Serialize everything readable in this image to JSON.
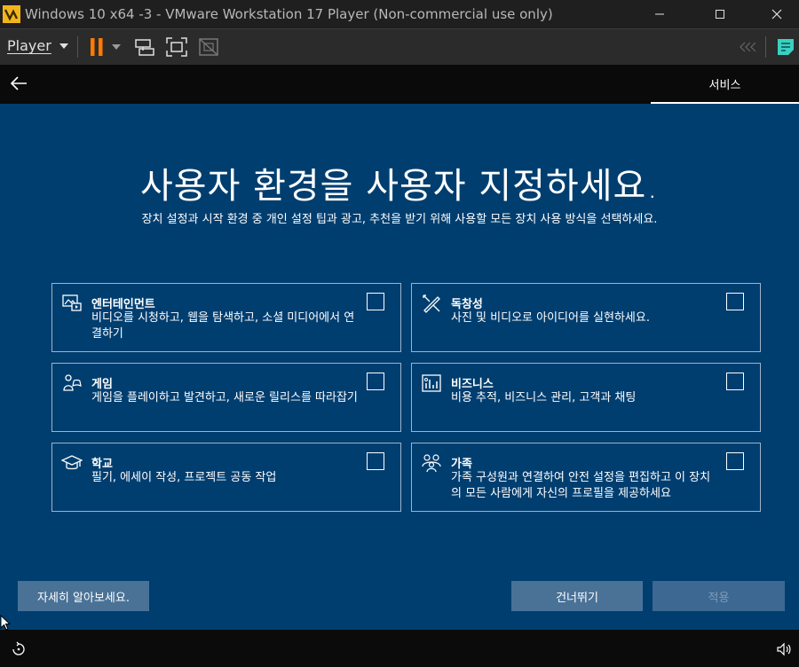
{
  "window": {
    "title": "Windows 10 x64 -3 - VMware Workstation 17 Player (Non-commercial use only)",
    "minimize_glyph": "—",
    "maximize_glyph": "☐",
    "close_glyph": "✕"
  },
  "toolbar": {
    "player_label": "Player",
    "accent_color": "#ff7a00",
    "icons": [
      "pause-icon",
      "send-keys-icon",
      "fullscreen-icon",
      "unity-icon",
      "collapse-icon",
      "notes-icon"
    ]
  },
  "oobe": {
    "tab_label": "서비스",
    "heading": "사용자 환경을 사용자 지정하세요.",
    "subheading": "장치 설정과 시작 환경 중 개인 설정 팁과 광고, 추천을 받기 위해 사용할 모든 장치 사용 방식을 선택하세요.",
    "background_color": "#003e70",
    "cards": [
      {
        "icon": "entertainment-icon",
        "title": "엔터테인먼트",
        "desc": "비디오를 시청하고, 웹을 탐색하고, 소셜 미디어에서 연결하기",
        "checked": false
      },
      {
        "icon": "creativity-icon",
        "title": "독창성",
        "desc": "사진 및 비디오로 아이디어를 실현하세요.",
        "checked": false
      },
      {
        "icon": "gaming-icon",
        "title": "게임",
        "desc": "게임을 플레이하고 발견하고, 새로운 릴리스를 따라잡기",
        "checked": false
      },
      {
        "icon": "business-icon",
        "title": "비즈니스",
        "desc": "비용 추적, 비즈니스 관리, 고객과 채팅",
        "checked": false
      },
      {
        "icon": "school-icon",
        "title": "학교",
        "desc": "필기, 에세이 작성, 프로젝트 공동 작업",
        "checked": false
      },
      {
        "icon": "family-icon",
        "title": "가족",
        "desc": "가족 구성원과 연결하여 안전 설정을 편집하고 이 장치의 모든 사람에게 자신의 프로필을 제공하세요",
        "checked": false
      }
    ],
    "learn_more_label": "자세히 알아보세요.",
    "skip_label": "건너뛰기",
    "apply_label": "적용"
  },
  "statusbar": {
    "icons": [
      "ease-of-access-icon",
      "volume-icon"
    ]
  }
}
